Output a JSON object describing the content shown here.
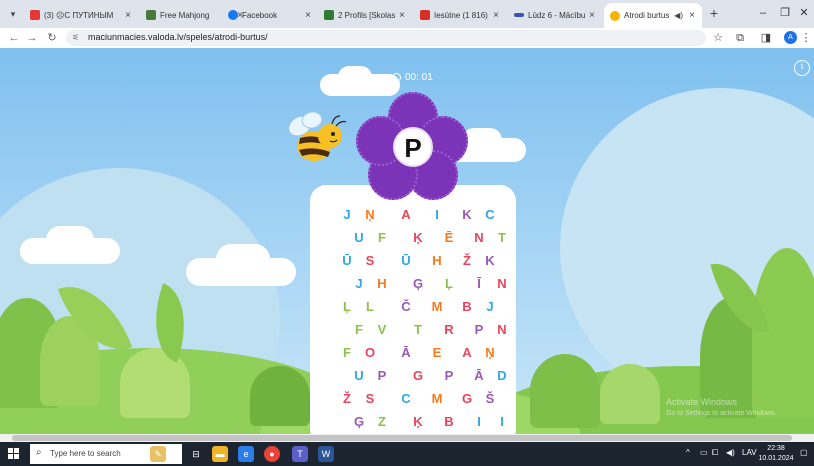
{
  "browser": {
    "tabs": [
      {
        "title": "(3) ☹С ПУТИНЫМ",
        "favicon_color": "#e53935"
      },
      {
        "title": "Free Mahjong",
        "favicon_color": "#4a7a3a"
      },
      {
        "title": "Facebook",
        "favicon_color": "#1877f2"
      },
      {
        "title": "2 Profils [Skolas admi",
        "favicon_color": "#2e7d32"
      },
      {
        "title": "Iesūtne (1 816) - ass",
        "favicon_color": "#d93025"
      },
      {
        "title": "Lūdz 6 - Mācību mate",
        "favicon_color": "#3f51b5"
      },
      {
        "title": "Atrodi burtus",
        "favicon_color": "#f5b400",
        "active": true
      }
    ],
    "url": "maciunmacies.valoda.lv/speles/atrodi-burtus/",
    "avatar_letter": "A"
  },
  "game": {
    "timer": "00: 01",
    "target_letter": "P",
    "grid": [
      [
        "J",
        "Ņ",
        "A",
        "I",
        "K",
        "C"
      ],
      [
        "U",
        "F",
        "Ķ",
        "Ē",
        "N",
        "T"
      ],
      [
        "Ū",
        "S",
        "Ū",
        "H",
        "Ž",
        "K"
      ],
      [
        "J",
        "H",
        "Ģ",
        "Ļ",
        "Ī",
        "N"
      ],
      [
        "Ļ",
        "L",
        "Č",
        "M",
        "B",
        "J"
      ],
      [
        "F",
        "V",
        "T",
        "R",
        "P",
        "N"
      ],
      [
        "F",
        "O",
        "Ā",
        "E",
        "A",
        "Ņ"
      ],
      [
        "U",
        "P",
        "G",
        "P",
        "Ā",
        "D"
      ],
      [
        "Ž",
        "S",
        "C",
        "M",
        "G",
        "Š"
      ],
      [
        "Ģ",
        "Z",
        "Ķ",
        "B",
        "I",
        "I"
      ]
    ],
    "colors": {
      "J": "#2ea8e6",
      "Ņ": "#f47b20",
      "A": "#e8455b",
      "I": "#2ea8e6",
      "K": "#9b59b6",
      "C": "#2ea8e6",
      "U": "#2ea8e6",
      "F": "#8bc34a",
      "Ķ": "#e8455b",
      "Ē": "#f47b20",
      "N": "#e8455b",
      "T": "#8bc34a",
      "Ū": "#2ea8e6",
      "S": "#e8455b",
      "H": "#f47b20",
      "Ž": "#e8455b",
      "Ģ": "#9b59b6",
      "Ļ": "#8bc34a",
      "Ī": "#9b59b6",
      "L": "#8bc34a",
      "Č": "#9b59b6",
      "M": "#f47b20",
      "B": "#e8455b",
      "V": "#8bc34a",
      "R": "#e8455b",
      "P": "#9b59b6",
      "O": "#e8455b",
      "Ā": "#9b59b6",
      "E": "#f47b20",
      "G": "#e8455b",
      "D": "#2ea8e6",
      "Š": "#9b59b6",
      "Z": "#8bc34a"
    },
    "accent": "#7b34b8"
  },
  "watermark": {
    "line1": "Activate Windows",
    "line2": "Go to Settings to activate Windows."
  },
  "taskbar": {
    "search_placeholder": "Type here to search",
    "time": "22:38",
    "date": "10.01.2024",
    "lang": "LAV"
  }
}
